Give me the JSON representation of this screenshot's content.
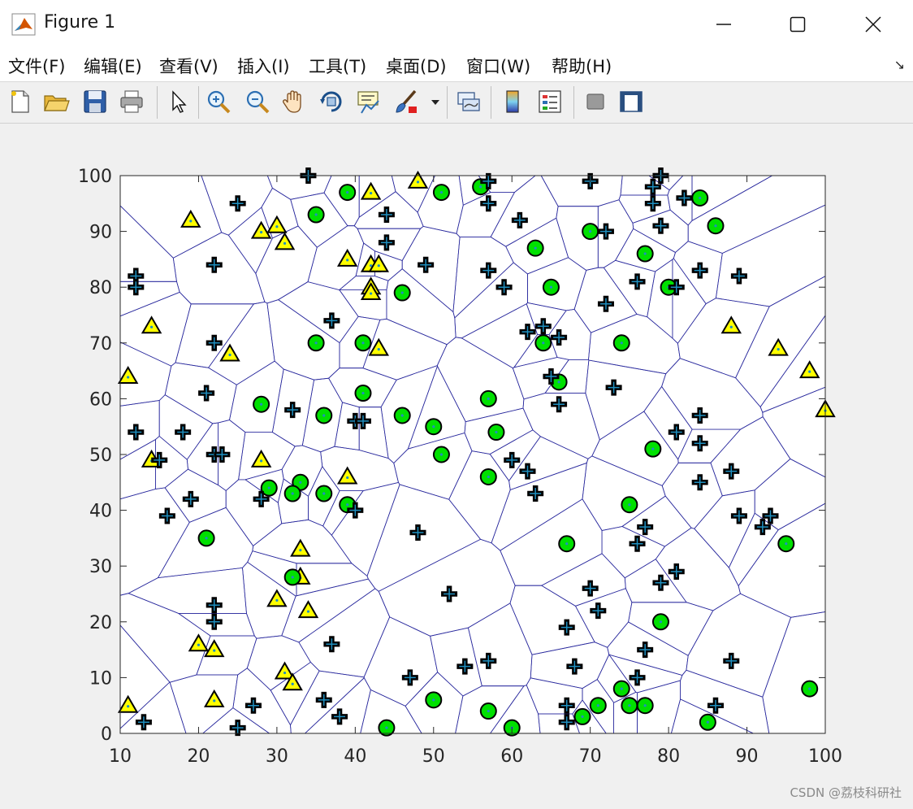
{
  "window": {
    "title": "Figure 1"
  },
  "menu": {
    "items": [
      "文件(F)",
      "编辑(E)",
      "查看(V)",
      "插入(I)",
      "工具(T)",
      "桌面(D)",
      "窗口(W)",
      "帮助(H)"
    ]
  },
  "toolbar": {
    "icons": [
      "new-figure-icon",
      "open-file-icon",
      "save-icon",
      "print-icon",
      "pointer-icon",
      "zoom-in-icon",
      "zoom-out-icon",
      "pan-hand-icon",
      "rotate-3d-icon",
      "data-cursor-icon",
      "brush-icon",
      "link-plot-icon",
      "colorbar-icon",
      "legend-icon",
      "hide-plot-tools-icon",
      "show-plot-tools-icon"
    ]
  },
  "watermark": "CSDN @荔枝科研社",
  "chart_data": {
    "type": "scatter",
    "title": "",
    "xlabel": "",
    "ylabel": "",
    "xlim": [
      10,
      100
    ],
    "ylim": [
      0,
      100
    ],
    "xticks": [
      10,
      20,
      30,
      40,
      50,
      60,
      70,
      80,
      90,
      100
    ],
    "yticks": [
      0,
      10,
      20,
      30,
      40,
      50,
      60,
      70,
      80,
      90,
      100
    ],
    "grid": false,
    "overlay": "voronoi",
    "colors": {
      "cross": "#000000",
      "cross_inner": "#1f8fbf",
      "circle": "#00e000",
      "triangle": "#ffff00",
      "edge": "#2b2b9e"
    },
    "series": [
      {
        "marker": "triangle",
        "points": [
          [
            19,
            92
          ],
          [
            28,
            90
          ],
          [
            30,
            91
          ],
          [
            31,
            88
          ],
          [
            42,
            97
          ],
          [
            48,
            99
          ],
          [
            39,
            85
          ],
          [
            42,
            84
          ],
          [
            43,
            84
          ],
          [
            42,
            80
          ],
          [
            42,
            79
          ],
          [
            14,
            73
          ],
          [
            24,
            68
          ],
          [
            43,
            69
          ],
          [
            11,
            64
          ],
          [
            14,
            49
          ],
          [
            28,
            49
          ],
          [
            39,
            46
          ],
          [
            33,
            33
          ],
          [
            33,
            28
          ],
          [
            30,
            24
          ],
          [
            34,
            22
          ],
          [
            20,
            16
          ],
          [
            22,
            15
          ],
          [
            22,
            6
          ],
          [
            31,
            11
          ],
          [
            32,
            9
          ],
          [
            11,
            5
          ],
          [
            88,
            73
          ],
          [
            94,
            69
          ],
          [
            98,
            65
          ],
          [
            100,
            58
          ]
        ]
      },
      {
        "marker": "circle",
        "points": [
          [
            39,
            97
          ],
          [
            35,
            93
          ],
          [
            51,
            97
          ],
          [
            56,
            98
          ],
          [
            46,
            79
          ],
          [
            63,
            87
          ],
          [
            65,
            80
          ],
          [
            70,
            90
          ],
          [
            77,
            86
          ],
          [
            80,
            80
          ],
          [
            84,
            96
          ],
          [
            86,
            91
          ],
          [
            35,
            70
          ],
          [
            41,
            70
          ],
          [
            64,
            70
          ],
          [
            74,
            70
          ],
          [
            28,
            59
          ],
          [
            36,
            57
          ],
          [
            41,
            61
          ],
          [
            46,
            57
          ],
          [
            50,
            55
          ],
          [
            51,
            50
          ],
          [
            57,
            60
          ],
          [
            58,
            54
          ],
          [
            57,
            46
          ],
          [
            66,
            63
          ],
          [
            29,
            44
          ],
          [
            33,
            45
          ],
          [
            36,
            43
          ],
          [
            32,
            43
          ],
          [
            39,
            41
          ],
          [
            21,
            35
          ],
          [
            32,
            28
          ],
          [
            67,
            34
          ],
          [
            75,
            41
          ],
          [
            78,
            51
          ],
          [
            95,
            34
          ],
          [
            79,
            20
          ],
          [
            50,
            6
          ],
          [
            44,
            1
          ],
          [
            57,
            4
          ],
          [
            60,
            1
          ],
          [
            69,
            3
          ],
          [
            71,
            5
          ],
          [
            74,
            8
          ],
          [
            75,
            5
          ],
          [
            77,
            5
          ],
          [
            85,
            2
          ],
          [
            98,
            8
          ]
        ]
      },
      {
        "marker": "cross",
        "points": [
          [
            34,
            100
          ],
          [
            25,
            95
          ],
          [
            44,
            93
          ],
          [
            44,
            88
          ],
          [
            22,
            84
          ],
          [
            12,
            82
          ],
          [
            12,
            80
          ],
          [
            49,
            84
          ],
          [
            57,
            99
          ],
          [
            57,
            95
          ],
          [
            61,
            92
          ],
          [
            70,
            99
          ],
          [
            78,
            98
          ],
          [
            79,
            100
          ],
          [
            78,
            95
          ],
          [
            79,
            91
          ],
          [
            82,
            96
          ],
          [
            57,
            83
          ],
          [
            59,
            80
          ],
          [
            72,
            90
          ],
          [
            72,
            77
          ],
          [
            76,
            81
          ],
          [
            81,
            80
          ],
          [
            84,
            83
          ],
          [
            89,
            82
          ],
          [
            37,
            74
          ],
          [
            22,
            70
          ],
          [
            62,
            72
          ],
          [
            64,
            73
          ],
          [
            66,
            71
          ],
          [
            65,
            64
          ],
          [
            66,
            59
          ],
          [
            73,
            62
          ],
          [
            21,
            61
          ],
          [
            12,
            54
          ],
          [
            18,
            54
          ],
          [
            32,
            58
          ],
          [
            40,
            56
          ],
          [
            41,
            56
          ],
          [
            22,
            50
          ],
          [
            23,
            50
          ],
          [
            15,
            49
          ],
          [
            60,
            49
          ],
          [
            62,
            47
          ],
          [
            63,
            43
          ],
          [
            81,
            54
          ],
          [
            84,
            57
          ],
          [
            84,
            52
          ],
          [
            84,
            45
          ],
          [
            88,
            47
          ],
          [
            19,
            42
          ],
          [
            16,
            39
          ],
          [
            28,
            42
          ],
          [
            40,
            40
          ],
          [
            48,
            36
          ],
          [
            77,
            37
          ],
          [
            76,
            34
          ],
          [
            81,
            29
          ],
          [
            79,
            27
          ],
          [
            89,
            39
          ],
          [
            93,
            39
          ],
          [
            92,
            37
          ],
          [
            52,
            25
          ],
          [
            70,
            26
          ],
          [
            71,
            22
          ],
          [
            22,
            23
          ],
          [
            22,
            20
          ],
          [
            67,
            19
          ],
          [
            37,
            16
          ],
          [
            47,
            10
          ],
          [
            54,
            12
          ],
          [
            57,
            13
          ],
          [
            68,
            12
          ],
          [
            77,
            15
          ],
          [
            76,
            10
          ],
          [
            88,
            13
          ],
          [
            36,
            6
          ],
          [
            38,
            3
          ],
          [
            27,
            5
          ],
          [
            13,
            2
          ],
          [
            25,
            1
          ],
          [
            67,
            5
          ],
          [
            67,
            2
          ],
          [
            86,
            5
          ]
        ]
      }
    ]
  }
}
